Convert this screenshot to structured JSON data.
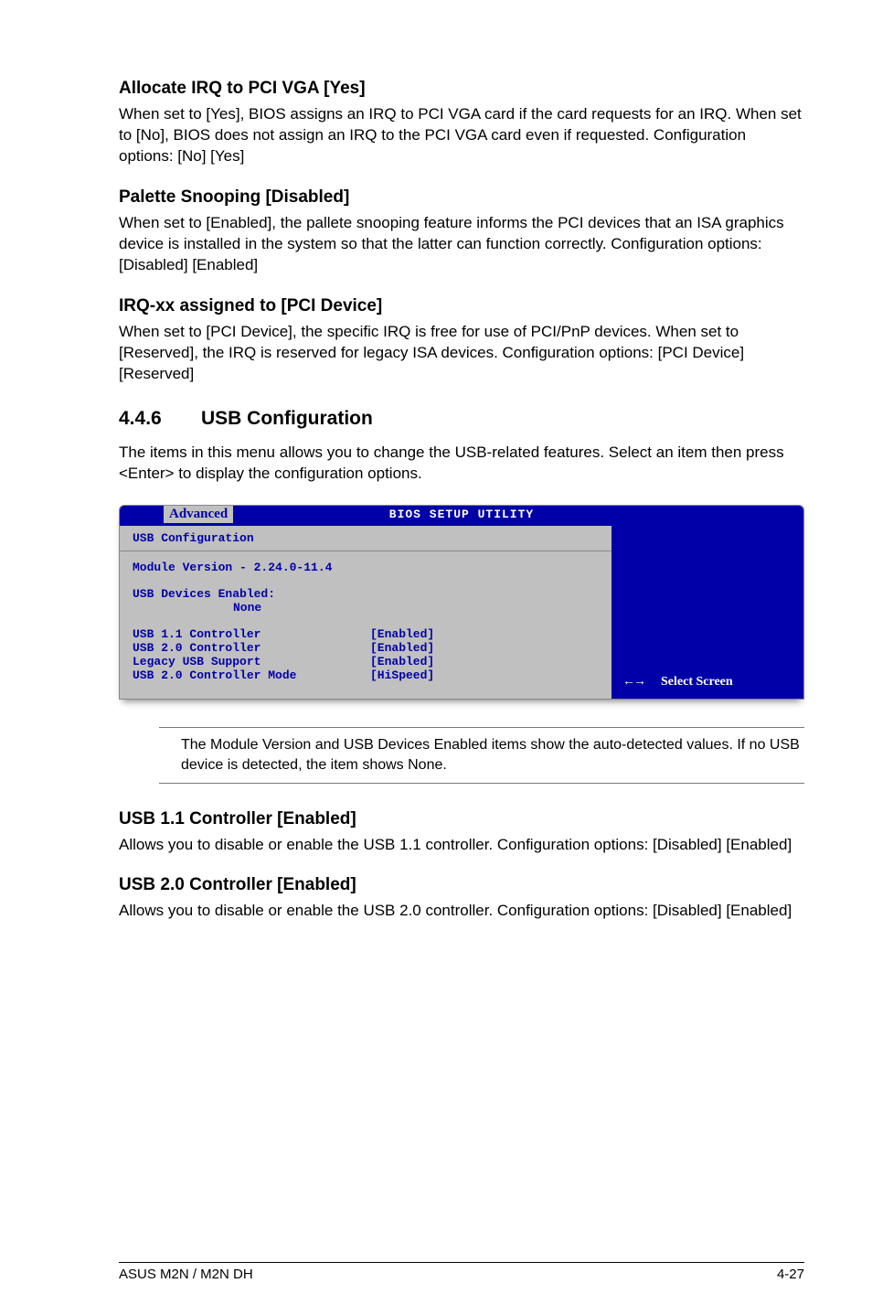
{
  "section1": {
    "title": "Allocate IRQ to PCI VGA [Yes]",
    "body": "When set to [Yes], BIOS assigns an IRQ to PCI VGA card if the card requests for an IRQ. When set to [No], BIOS does not assign an IRQ to the PCI VGA card even if requested. Configuration options: [No] [Yes]"
  },
  "section2": {
    "title": "Palette Snooping [Disabled]",
    "body": "When set to [Enabled], the pallete snooping feature informs the PCI devices that an ISA graphics device is installed in the system so that the latter can function correctly. Configuration options: [Disabled] [Enabled]"
  },
  "section3": {
    "title": "IRQ-xx assigned to [PCI Device]",
    "body": "When set to [PCI Device], the specific IRQ is free for use of PCI/PnP devices. When set to [Reserved], the IRQ is reserved for legacy ISA devices. Configuration options: [PCI Device] [Reserved]"
  },
  "subsection": {
    "number": "4.4.6",
    "title": "USB Configuration",
    "intro": "The items in this menu allows you to change the USB-related features. Select an item then press <Enter> to display the configuration options."
  },
  "bios": {
    "header_title": "BIOS SETUP UTILITY",
    "tab": "Advanced",
    "panel_title": "USB Configuration",
    "module_line": "Module Version - 2.24.0-11.4",
    "devices_label": "USB Devices Enabled:",
    "devices_value": "None",
    "rows": [
      {
        "label": "USB 1.1 Controller",
        "value": "[Enabled]"
      },
      {
        "label": "USB 2.0 Controller",
        "value": "[Enabled]"
      },
      {
        "label": "Legacy USB Support",
        "value": "[Enabled]"
      },
      {
        "label": "USB 2.0 Controller Mode",
        "value": "[HiSpeed]"
      }
    ],
    "help_arrow": "←→",
    "help_text": "Select Screen"
  },
  "note": "The Module Version and USB Devices Enabled items show the auto-detected values. If no USB device is detected, the item shows None.",
  "section4": {
    "title": "USB 1.1 Controller [Enabled]",
    "body": "Allows you to disable or enable the USB 1.1 controller. Configuration options: [Disabled] [Enabled]"
  },
  "section5": {
    "title": "USB 2.0 Controller [Enabled]",
    "body": "Allows you to disable or enable the USB 2.0 controller. Configuration options: [Disabled] [Enabled]"
  },
  "footer": {
    "left": "ASUS M2N / M2N DH",
    "right": "4-27"
  }
}
